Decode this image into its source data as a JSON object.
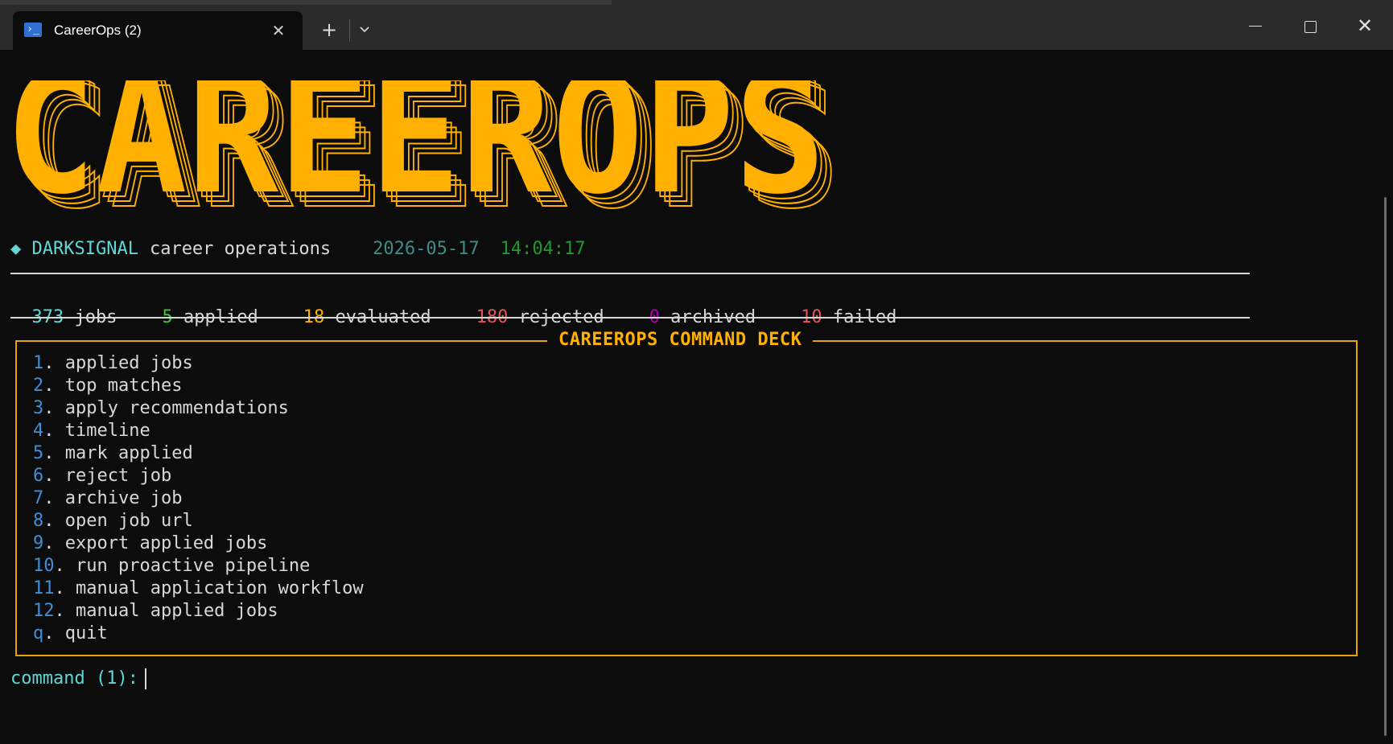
{
  "window": {
    "tab_title": "CareerOps (2)",
    "tab_icon": "powershell-icon",
    "tab_close_glyph": "✕",
    "new_tab_glyph": "+",
    "dropdown_glyph": "⌄",
    "close_glyph": "✕"
  },
  "banner": {
    "text": "CAREEROPS",
    "color": "#ffb000",
    "outline_color": "#ffb000"
  },
  "header": {
    "diamond": "◆",
    "brand": "DARKSIGNAL",
    "tagline": "career operations",
    "date": "2026-05-17",
    "time": "14:04:17"
  },
  "stats": [
    {
      "value": "373",
      "label": "jobs",
      "color": "#5fd7d7"
    },
    {
      "value": "5",
      "label": "applied",
      "color": "#3cc83c"
    },
    {
      "value": "18",
      "label": "evaluated",
      "color": "#ffb000"
    },
    {
      "value": "180",
      "label": "rejected",
      "color": "#e05560"
    },
    {
      "value": "0",
      "label": "archived",
      "color": "#b000b0"
    },
    {
      "value": "10",
      "label": "failed",
      "color": "#e05560"
    }
  ],
  "deck": {
    "title": "CAREEROPS COMMAND DECK",
    "items": [
      {
        "key": "1",
        "label": "applied jobs"
      },
      {
        "key": "2",
        "label": "top matches"
      },
      {
        "key": "3",
        "label": "apply recommendations"
      },
      {
        "key": "4",
        "label": "timeline"
      },
      {
        "key": "5",
        "label": "mark applied"
      },
      {
        "key": "6",
        "label": "reject job"
      },
      {
        "key": "7",
        "label": "archive job"
      },
      {
        "key": "8",
        "label": "open job url"
      },
      {
        "key": "9",
        "label": "export applied jobs"
      },
      {
        "key": "10",
        "label": "run proactive pipeline"
      },
      {
        "key": "11",
        "label": "manual application workflow"
      },
      {
        "key": "12",
        "label": "manual applied jobs"
      },
      {
        "key": "q",
        "label": "quit"
      }
    ]
  },
  "prompt": {
    "text": "command (1):",
    "value": ""
  }
}
